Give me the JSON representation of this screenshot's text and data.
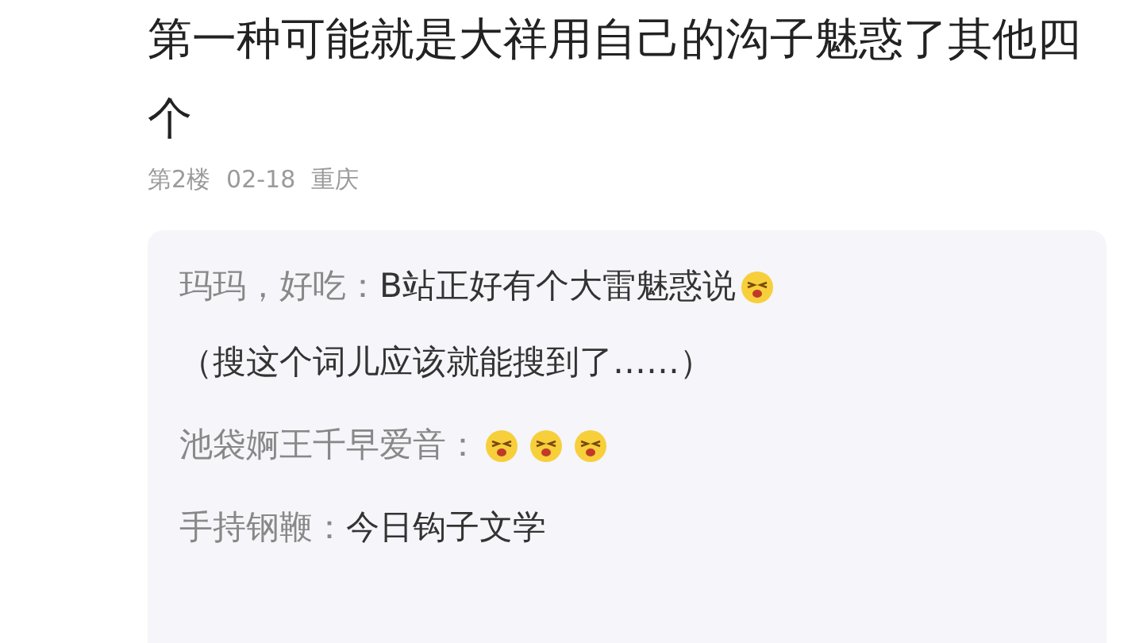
{
  "post": {
    "text": "第一种可能就是大祥用自己的沟子魅惑了其他四个",
    "floor": "第2楼",
    "date": "02-18",
    "location": "重庆"
  },
  "replies": [
    {
      "user": "玛玛，好吃：",
      "content": [
        {
          "kind": "text",
          "text": "B站正好有个大雷魅惑说"
        },
        {
          "kind": "emoji"
        },
        {
          "kind": "line",
          "text": "（搜这个词儿应该就能搜到了……）"
        }
      ]
    },
    {
      "user": "池袋婀王千早爱音：",
      "content": [
        {
          "kind": "emoji"
        },
        {
          "kind": "emoji"
        },
        {
          "kind": "emoji"
        }
      ]
    },
    {
      "user": "手持钢鞭：",
      "content": [
        {
          "kind": "text",
          "text": "今日钩子文学"
        }
      ]
    }
  ]
}
